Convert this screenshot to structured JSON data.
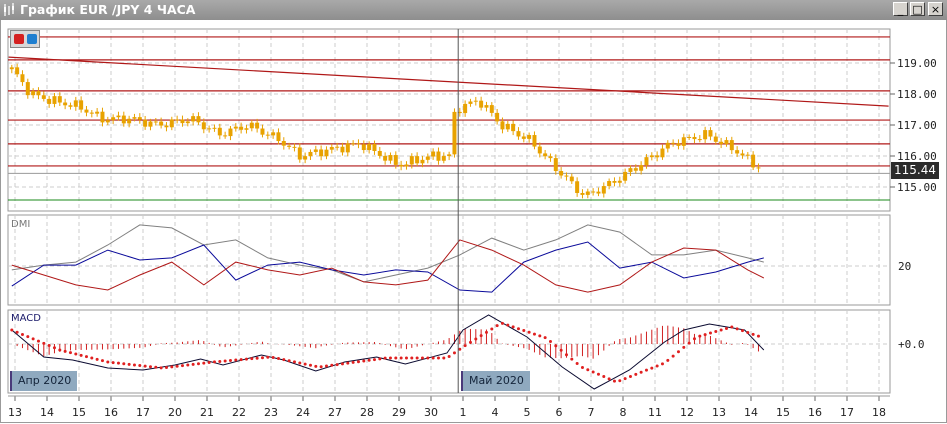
{
  "window": {
    "title": "График EUR /JPY  4 ЧАСА",
    "minimize": "_",
    "maximize": "□",
    "close": "×"
  },
  "colors": {
    "candle": "#e8a200",
    "level": "#b01818",
    "green_level": "#1a8a1a",
    "adx": "#808080",
    "plus_di": "#0a0a9a",
    "minus_di": "#b01818",
    "macd": "#0a0a30",
    "signal": "#e02020",
    "hist": "#d02020"
  },
  "price_axis": {
    "ticks": [
      "119.00",
      "118.00",
      "117.00",
      "116.00",
      "115.00"
    ],
    "tick_values": [
      119,
      118,
      117,
      116,
      115
    ],
    "current": "115.44",
    "current_value": 115.44
  },
  "levels": [
    119.84,
    119.1,
    118.1,
    117.16,
    116.39,
    115.68
  ],
  "green_level": 114.58,
  "trendline": {
    "from": [
      -0.2,
      119.19
    ],
    "to": [
      27.3,
      117.61
    ]
  },
  "price_path": [
    [
      -0.1,
      118.8
    ],
    [
      0.5,
      118.0
    ],
    [
      1.1,
      117.8
    ],
    [
      2.0,
      117.6
    ],
    [
      2.7,
      117.2
    ],
    [
      3.6,
      117.2
    ],
    [
      4.5,
      117.0
    ],
    [
      5.5,
      117.2
    ],
    [
      6.4,
      116.7
    ],
    [
      7.3,
      117.0
    ],
    [
      8.3,
      116.5
    ],
    [
      8.9,
      116.0
    ],
    [
      9.8,
      116.2
    ],
    [
      10.8,
      116.4
    ],
    [
      12.0,
      115.7
    ],
    [
      13.0,
      116.0
    ],
    [
      13.6,
      116.0
    ],
    [
      13.75,
      117.5
    ],
    [
      14.5,
      117.8
    ],
    [
      15.2,
      117.0
    ],
    [
      16.1,
      116.5
    ],
    [
      17.0,
      115.5
    ],
    [
      17.8,
      114.7
    ],
    [
      18.6,
      115.1
    ],
    [
      19.5,
      115.7
    ],
    [
      20.5,
      116.4
    ],
    [
      21.6,
      116.7
    ],
    [
      22.5,
      116.2
    ],
    [
      23.4,
      115.5
    ]
  ],
  "dmi": {
    "label": "DMI",
    "level_label": "20",
    "start": -0.1,
    "step": 1,
    "adx": [
      18.7,
      20.3,
      21.3,
      27,
      33.7,
      32.7,
      27,
      28.7,
      22.7,
      20.3,
      18.7,
      14.7,
      17,
      19.3,
      23.7,
      29.3,
      25.3,
      28.7,
      33.7,
      31.3,
      23.7,
      23.7,
      25.3,
      22.7,
      21.3
    ],
    "plus_di": [
      13.3,
      20.3,
      20.3,
      25.3,
      22,
      22.7,
      27,
      15.3,
      20.3,
      21.3,
      18.7,
      17,
      18.7,
      18,
      12,
      11.3,
      21.3,
      25.3,
      28,
      19.3,
      21.3,
      16,
      18,
      21.3,
      22.7
    ],
    "minus_di": [
      20.3,
      17,
      13.7,
      12,
      17,
      21.3,
      13.7,
      21.3,
      18.7,
      17,
      19.3,
      14.7,
      13.7,
      15.3,
      28.7,
      25.3,
      20.3,
      13.7,
      11.3,
      13.7,
      21.3,
      26,
      25.3,
      18.7,
      16
    ]
  },
  "macd": {
    "label": "MACD",
    "zero_label": "+0.0",
    "main": [
      [
        -0.1,
        0.14
      ],
      [
        0.9,
        -0.13
      ],
      [
        1.8,
        -0.16
      ],
      [
        2.9,
        -0.24
      ],
      [
        4.0,
        -0.26
      ],
      [
        5.0,
        -0.21
      ],
      [
        5.8,
        -0.15
      ],
      [
        6.5,
        -0.21
      ],
      [
        7.7,
        -0.11
      ],
      [
        8.4,
        -0.16
      ],
      [
        9.4,
        -0.27
      ],
      [
        10.3,
        -0.18
      ],
      [
        11.3,
        -0.13
      ],
      [
        12.2,
        -0.2
      ],
      [
        13.5,
        -0.09
      ],
      [
        14.0,
        0.14
      ],
      [
        14.8,
        0.29
      ],
      [
        16.0,
        0.07
      ],
      [
        17.1,
        -0.23
      ],
      [
        18.1,
        -0.45
      ],
      [
        19.2,
        -0.26
      ],
      [
        20.3,
        0.02
      ],
      [
        20.9,
        0.14
      ],
      [
        21.7,
        0.2
      ],
      [
        22.8,
        0.14
      ],
      [
        23.4,
        -0.06
      ]
    ],
    "signal": [
      [
        -0.1,
        0.14
      ],
      [
        1.4,
        -0.06
      ],
      [
        2.9,
        -0.18
      ],
      [
        4.6,
        -0.24
      ],
      [
        6.2,
        -0.18
      ],
      [
        8.0,
        -0.13
      ],
      [
        9.5,
        -0.23
      ],
      [
        11.6,
        -0.14
      ],
      [
        13.5,
        -0.14
      ],
      [
        14.0,
        -0.03
      ],
      [
        15.2,
        0.21
      ],
      [
        16.6,
        0.06
      ],
      [
        17.7,
        -0.23
      ],
      [
        18.8,
        -0.38
      ],
      [
        20.3,
        -0.19
      ],
      [
        21.3,
        0.07
      ],
      [
        22.4,
        0.17
      ],
      [
        23.4,
        0.06
      ]
    ]
  },
  "months": [
    {
      "label": "Апр 2020",
      "day": 0
    },
    {
      "label": "Май 2020",
      "day": 14
    }
  ],
  "dates": [
    "13",
    "14",
    "15",
    "16",
    "17",
    "20",
    "21",
    "22",
    "23",
    "24",
    "27",
    "28",
    "29",
    "30",
    "1",
    "4",
    "5",
    "6",
    "7",
    "8",
    "11",
    "12",
    "13",
    "14",
    "15",
    "16",
    "17",
    "18"
  ]
}
